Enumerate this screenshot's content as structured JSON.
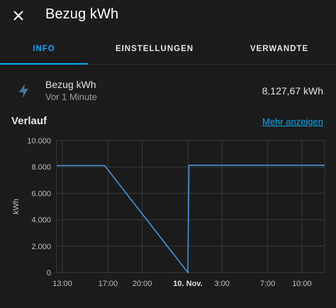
{
  "dialog": {
    "title": "Bezug kWh",
    "close_icon": "close-icon"
  },
  "tabs": [
    {
      "label": "INFO",
      "active": true
    },
    {
      "label": "EINSTELLUNGEN",
      "active": false
    },
    {
      "label": "VERWANDTE",
      "active": false
    }
  ],
  "entity": {
    "icon": "lightning-bolt-icon",
    "name": "Bezug kWh",
    "last_changed": "Vor 1 Minute",
    "state": "8.127,67 kWh"
  },
  "history": {
    "title": "Verlauf",
    "more_link": "Mehr anzeigen"
  },
  "colors": {
    "accent": "#03a9f4",
    "line": "#4a8fd1",
    "background": "#1c1c1c"
  },
  "chart_data": {
    "type": "line",
    "ylabel": "kWh",
    "ylim": [
      0,
      10000
    ],
    "y_ticks": [
      "0",
      "2.000",
      "4.000",
      "6.000",
      "8.000",
      "10.000"
    ],
    "x_ticks": [
      "13:00",
      "17:00",
      "20:00",
      "10. Nov.",
      "3:00",
      "7:00",
      "10:00"
    ],
    "x_ticks_hours": [
      13,
      17,
      20,
      24,
      27,
      31,
      34
    ],
    "xlim_hours": [
      12.5,
      36
    ],
    "grid": true,
    "series": [
      {
        "points": [
          {
            "x": 12.5,
            "y": 8100
          },
          {
            "x": 16.7,
            "y": 8100
          },
          {
            "x": 24.0,
            "y": 0
          },
          {
            "x": 24.1,
            "y": 8128
          },
          {
            "x": 36.0,
            "y": 8128
          }
        ]
      }
    ]
  }
}
